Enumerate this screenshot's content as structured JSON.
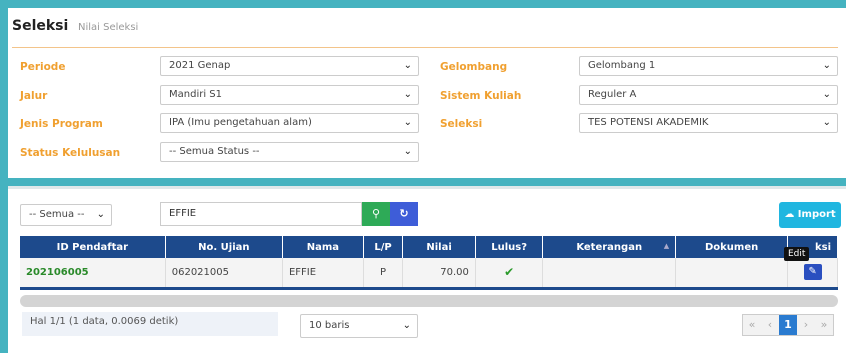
{
  "header": {
    "title": "Seleksi",
    "subtitle": "Nilai Seleksi"
  },
  "filters": {
    "periode": {
      "label": "Periode",
      "value": "2021 Genap"
    },
    "jalur": {
      "label": "Jalur",
      "value": "Mandiri S1"
    },
    "jenis_program": {
      "label": "Jenis Program",
      "value": "IPA (Imu pengetahuan alam)"
    },
    "status_kelulusan": {
      "label": "Status Kelulusan",
      "value": "-- Semua Status --"
    },
    "gelombang": {
      "label": "Gelombang",
      "value": "Gelombang 1"
    },
    "sistem_kuliah": {
      "label": "Sistem Kuliah",
      "value": "Reguler A"
    },
    "seleksi": {
      "label": "Seleksi",
      "value": "TES POTENSI AKADEMIK"
    }
  },
  "toolbar": {
    "filter_select": "-- Semua --",
    "search_value": "EFFIE",
    "import_label": "Import"
  },
  "table": {
    "columns": [
      "ID Pendaftar",
      "No. Ujian",
      "Nama",
      "L/P",
      "Nilai",
      "Lulus?",
      "Keterangan",
      "Dokumen",
      "Aksi"
    ],
    "header_aksi_partial": "ksi",
    "rows": [
      {
        "id": "202106005",
        "no_ujian": "062021005",
        "nama": "EFFIE",
        "lp": "P",
        "nilai": "70.00",
        "lulus": "✔",
        "keterangan": "",
        "dokumen": ""
      }
    ],
    "tooltip": "Edit"
  },
  "footer": {
    "status": "Hal 1/1 (1 data, 0.0069 detik)",
    "rows_select": "10 baris",
    "pager": {
      "first": "«",
      "prev": "‹",
      "current": "1",
      "next": "›",
      "last": "»"
    }
  },
  "colors": {
    "accent": "#f0a030",
    "header_bg": "#1d4a8c",
    "page_bg": "#45b3c0"
  }
}
